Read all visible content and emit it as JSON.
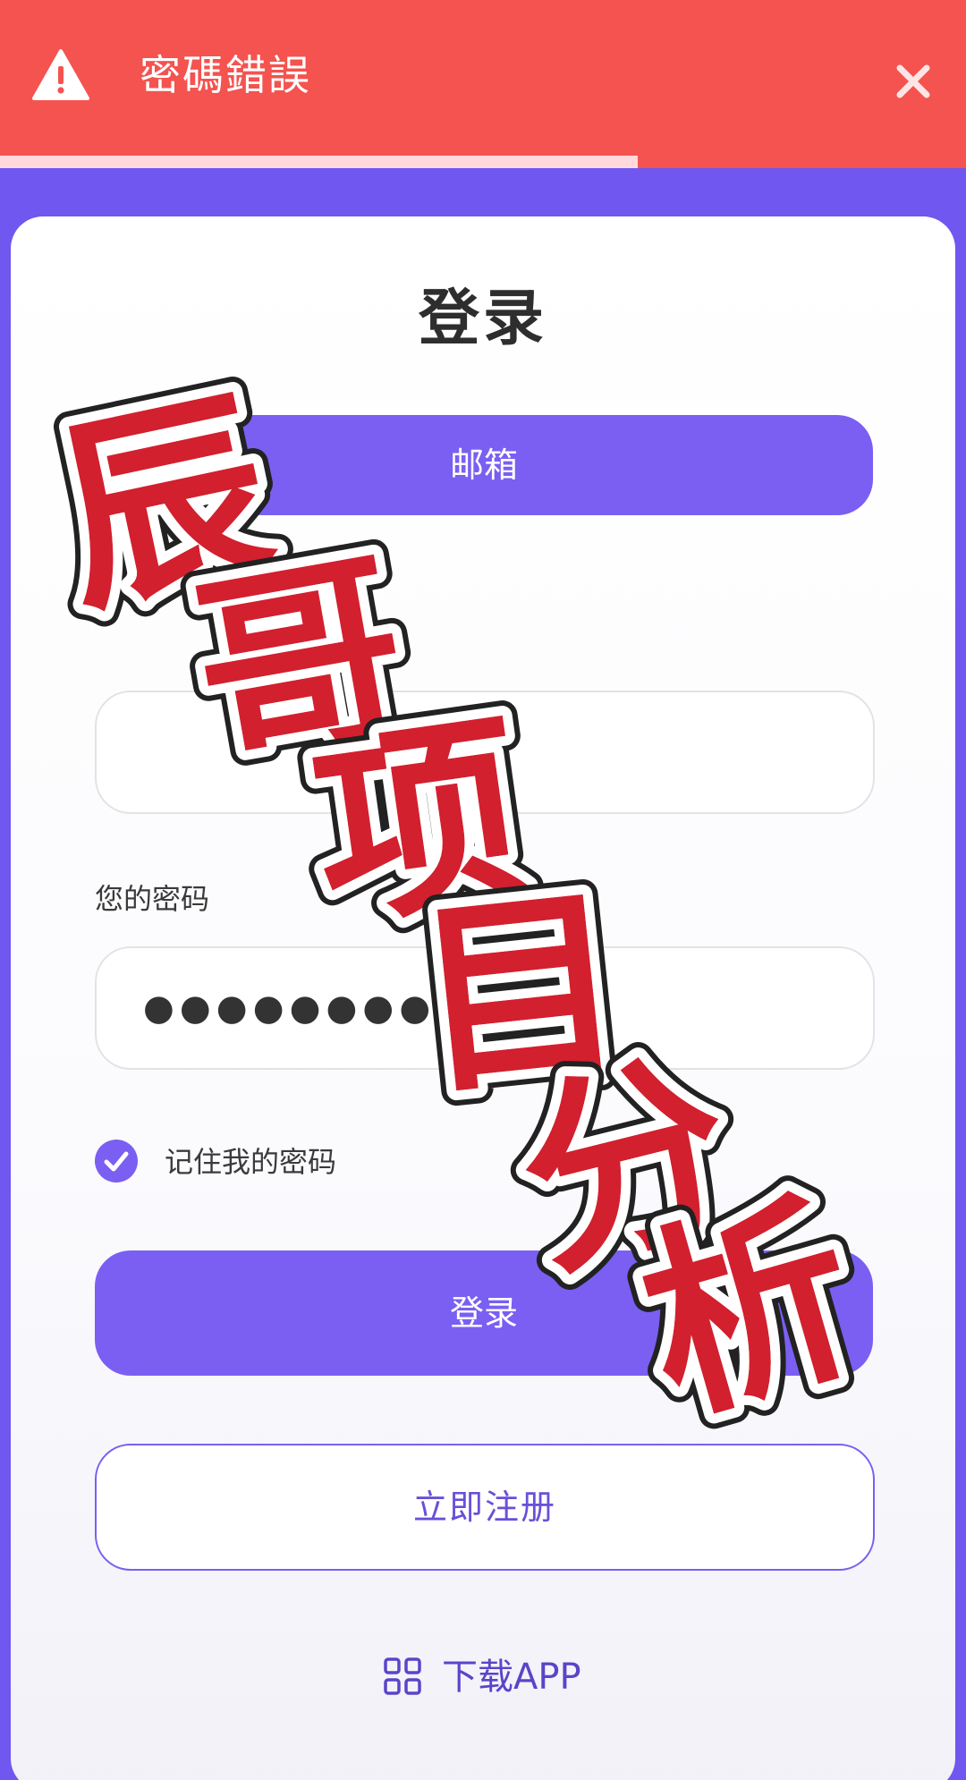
{
  "toast": {
    "title": "密碼錯誤",
    "icon": "warning-icon",
    "close_icon": "close-icon",
    "progress": 0.66,
    "color": "#f4534f"
  },
  "login": {
    "title": "登录",
    "email_tab_label": "邮箱",
    "email_value": "",
    "password_label": "您的密码",
    "password_value": "●●●●●●●●●●●",
    "remember_label": "记住我的密码",
    "remember_checked": true,
    "login_button": "登录",
    "register_button": "立即注册",
    "download_label": "下载APP",
    "download_icon": "grid-icon"
  },
  "watermark": {
    "text": [
      "辰",
      "哥",
      "项",
      "目",
      "分",
      "析"
    ]
  },
  "colors": {
    "accent": "#7a5ff2",
    "background": "#6f57f0",
    "watermark": "#d2202e"
  }
}
